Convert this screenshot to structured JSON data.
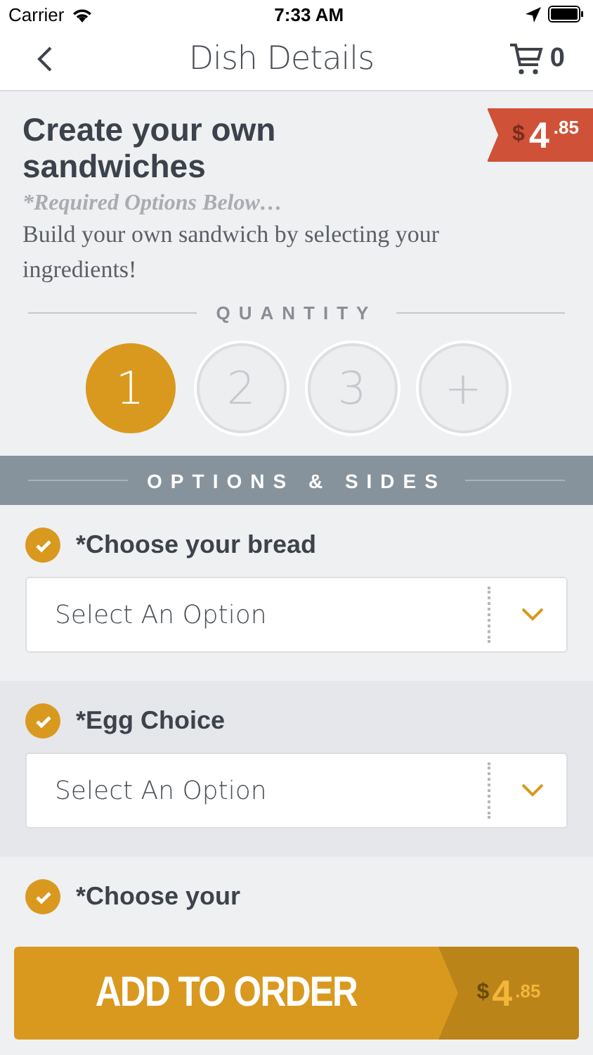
{
  "status_bar": {
    "carrier": "Carrier",
    "time": "7:33 AM"
  },
  "nav": {
    "title": "Dish Details",
    "cart_count": "0"
  },
  "dish": {
    "title": "Create your own sandwiches",
    "required_note": "*Required Options Below…",
    "description": "Build your own sandwich by selecting your ingredients!",
    "price": {
      "currency": "$",
      "whole": "4",
      "fraction": ".85"
    }
  },
  "quantity": {
    "label": "QUANTITY",
    "options": [
      {
        "label": "1",
        "selected": true
      },
      {
        "label": "2",
        "selected": false
      },
      {
        "label": "3",
        "selected": false
      },
      {
        "label": "+",
        "selected": false
      }
    ]
  },
  "options_header": "OPTIONS & SIDES",
  "option_groups": [
    {
      "title": "*Choose your bread",
      "checked": true,
      "placeholder": "Select An Option"
    },
    {
      "title": "*Egg Choice",
      "checked": true,
      "placeholder": "Select An Option"
    },
    {
      "title": "*Choose your",
      "checked": true
    }
  ],
  "add_button": {
    "label": "ADD TO ORDER",
    "price": {
      "currency": "$",
      "whole": "4",
      "fraction": ".85"
    }
  }
}
